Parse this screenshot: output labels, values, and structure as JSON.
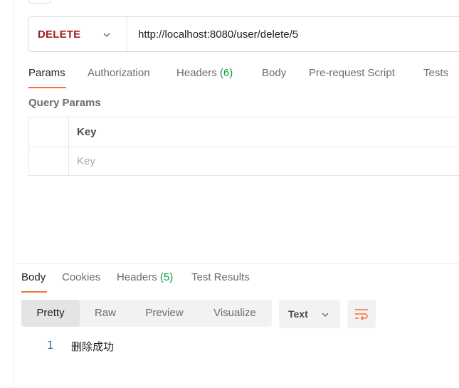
{
  "request": {
    "method": "DELETE",
    "url": "http://localhost:8080/user/delete/5"
  },
  "request_tabs": [
    {
      "label": "Params",
      "active": true
    },
    {
      "label": "Authorization"
    },
    {
      "label": "Headers",
      "count": "(6)"
    },
    {
      "label": "Body"
    },
    {
      "label": "Pre-request Script"
    },
    {
      "label": "Tests"
    }
  ],
  "query_params": {
    "title": "Query Params",
    "column_key": "Key",
    "key_placeholder": "Key"
  },
  "response_tabs": [
    {
      "label": "Body",
      "active": true
    },
    {
      "label": "Cookies"
    },
    {
      "label": "Headers",
      "count": "(5)"
    },
    {
      "label": "Test Results"
    }
  ],
  "format_options": [
    "Pretty",
    "Raw",
    "Preview",
    "Visualize"
  ],
  "format_selected": "Pretty",
  "body_type": "Text",
  "response": {
    "line_number": "1",
    "text": "删除成功"
  },
  "icons": {
    "method_dropdown": "chevron-down-icon",
    "type_dropdown": "chevron-down-icon",
    "wrap": "wrap-lines-icon"
  },
  "colors": {
    "accent": "#ff6c37",
    "method": "#a61d1d",
    "count": "#0c9b40",
    "line_number": "#2a7a8c"
  }
}
